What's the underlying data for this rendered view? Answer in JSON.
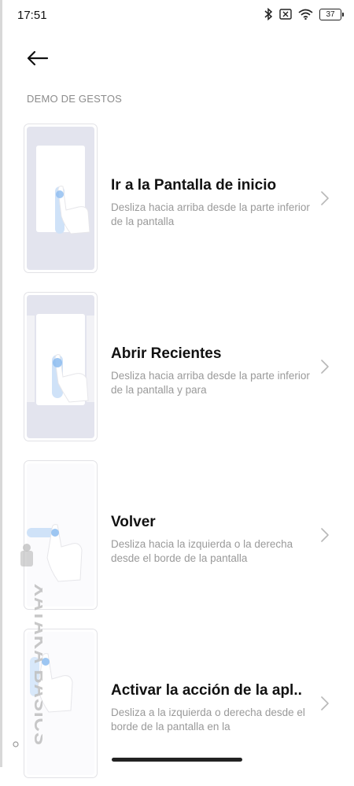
{
  "status_bar": {
    "time": "17:51",
    "battery": "37"
  },
  "section_header": "DEMO DE GESTOS",
  "gestures": [
    {
      "title": "Ir a la Pantalla de inicio",
      "description": "Desliza hacia arriba desde la parte inferior de la pantalla"
    },
    {
      "title": "Abrir Recientes",
      "description": "Desliza hacia arriba desde la parte inferior de la pantalla y para"
    },
    {
      "title": "Volver",
      "description": "Desliza hacia la izquierda o la derecha desde el borde de la pantalla"
    },
    {
      "title": "Activar la acción de la apl..",
      "description": "Desliza a la izquierda o derecha desde el borde de la pantalla en la"
    }
  ],
  "watermark": "XATAKA BASICS",
  "icons": [
    "bluetooth-icon",
    "sim-off-icon",
    "wifi-icon",
    "battery-icon",
    "back-arrow-icon",
    "chevron-right-icon",
    "hand-icon"
  ],
  "colors": {
    "thumb_bg": "#e3e4ee",
    "touch_blue": "#7fb0ea",
    "text_primary": "#111111",
    "text_secondary": "#9a9a9a"
  }
}
